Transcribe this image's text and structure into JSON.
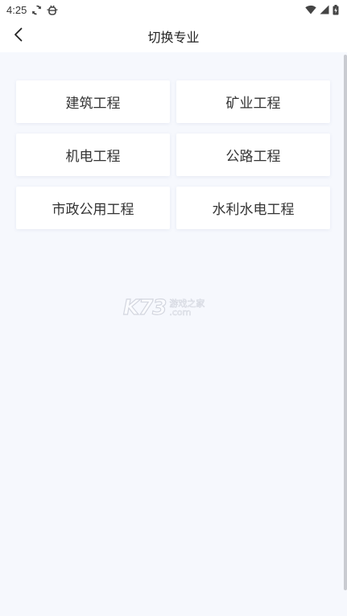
{
  "status_bar": {
    "time": "4:25",
    "icons": [
      "sync-icon",
      "bug-icon",
      "wifi-icon",
      "signal-icon",
      "battery-icon"
    ]
  },
  "app_bar": {
    "title": "切换专业",
    "back_icon": "chevron-left-icon"
  },
  "majors": [
    {
      "label": "建筑工程"
    },
    {
      "label": "矿业工程"
    },
    {
      "label": "机电工程"
    },
    {
      "label": "公路工程"
    },
    {
      "label": "市政公用工程"
    },
    {
      "label": "水利水电工程"
    }
  ],
  "watermark": {
    "brand": "K73",
    "cn": "游戏之家",
    "domain": ".com"
  },
  "colors": {
    "background": "#f6f8fd",
    "card": "#ffffff",
    "text": "#333333"
  }
}
